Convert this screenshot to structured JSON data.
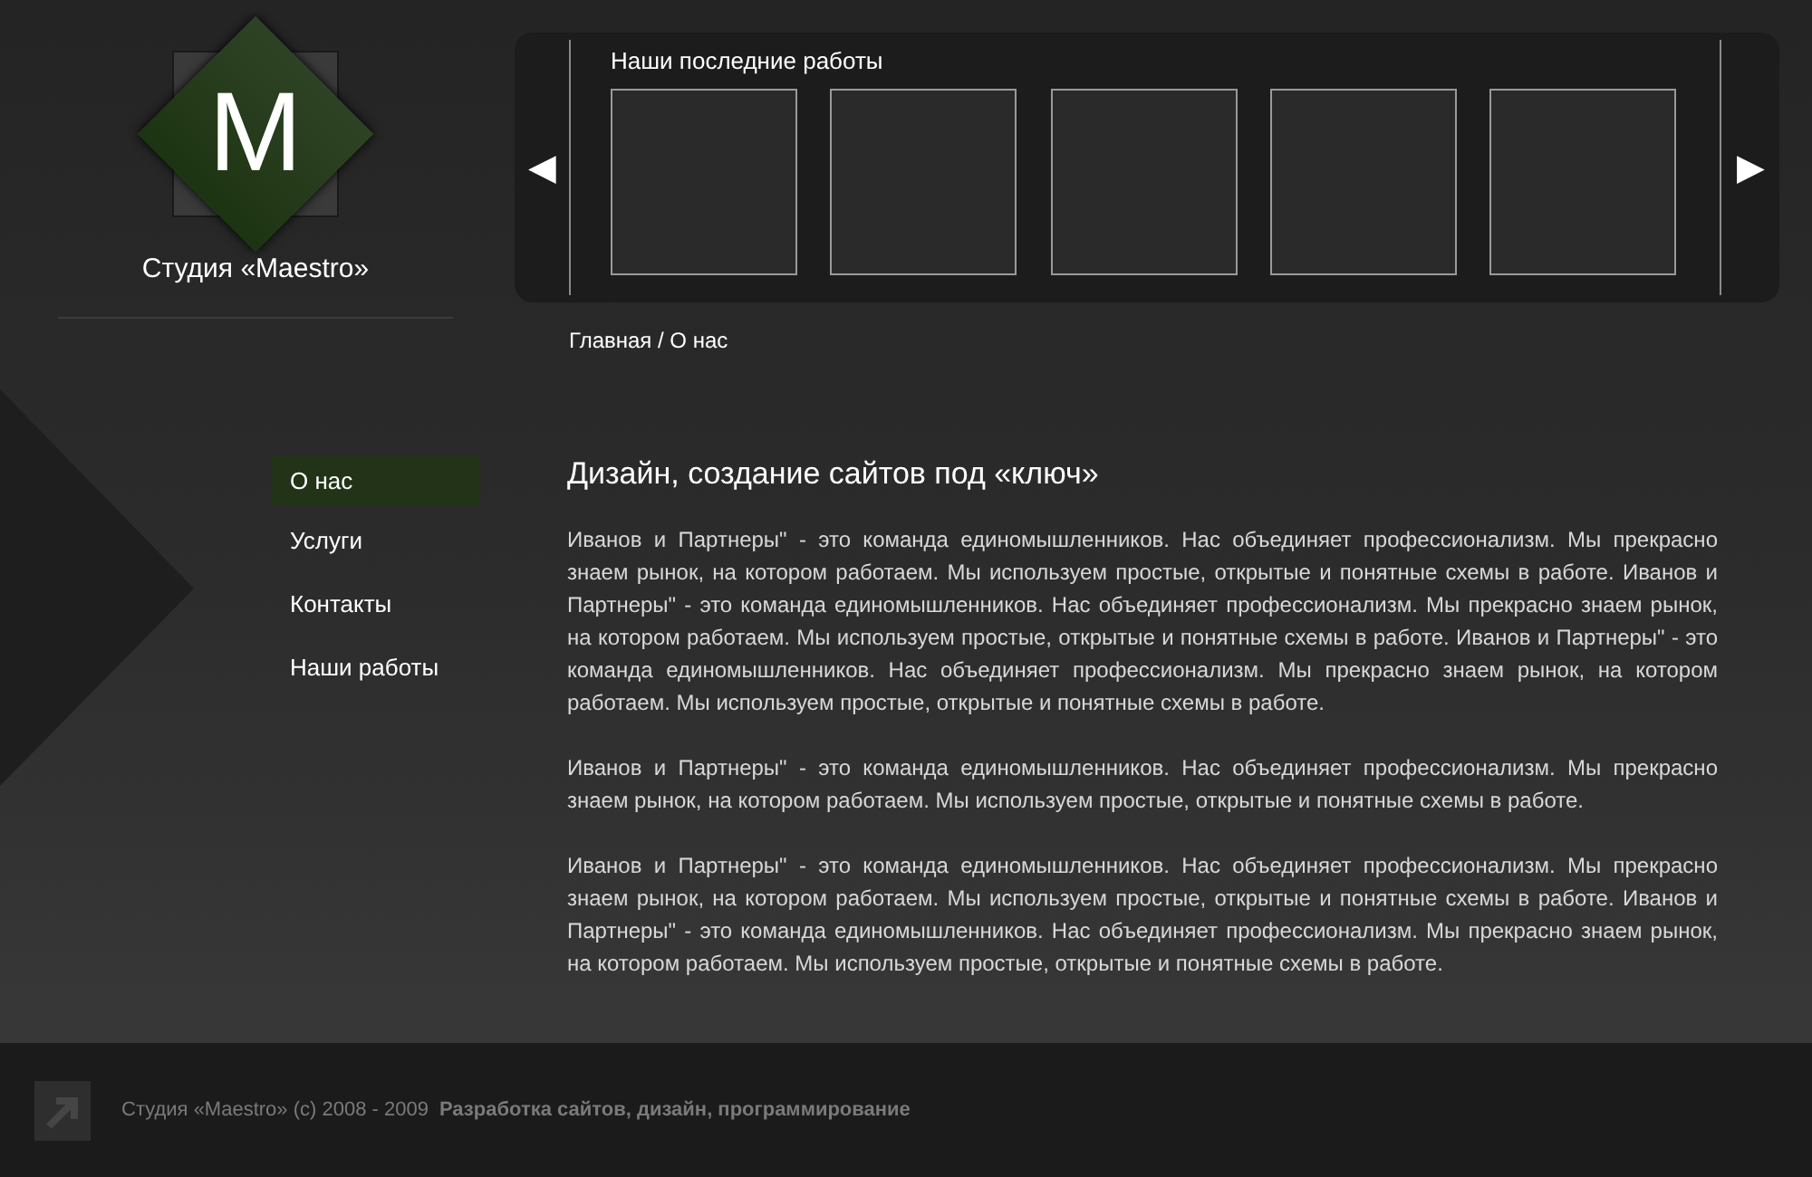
{
  "logo": {
    "letter": "M",
    "name": "Студия «Maestro»"
  },
  "slider": {
    "title": "Наши последние работы",
    "prev": "◀",
    "next": "▶",
    "works": [
      {
        "kind": "empty"
      },
      {
        "kind": "empty"
      },
      {
        "kind": "empty"
      },
      {
        "kind": "empty"
      },
      {
        "kind": "empty"
      }
    ]
  },
  "breadcrumb": "Главная / О нас",
  "menu": [
    {
      "label": "О нас",
      "selected": true
    },
    {
      "label": "Услуги",
      "selected": false
    },
    {
      "label": "Контакты",
      "selected": false
    },
    {
      "label": "Наши работы",
      "selected": false
    }
  ],
  "heading": "Дизайн, создание сайтов под «ключ»",
  "paragraphs": [
    "Иванов и Партнеры\" - это команда единомышленников. Нас объединяет профессионализм. Мы прекрасно знаем рынок, на котором работаем. Мы используем простые, открытые и понятные схемы в работе. Иванов и Партнеры\" - это команда единомышленников. Нас объединяет профессионализм. Мы прекрасно знаем рынок, на котором работаем. Мы используем простые, открытые и понятные схемы в работе. Иванов и Партнеры\" - это команда единомышленников. Нас объединяет профессионализм. Мы прекрасно знаем рынок, на котором работаем. Мы используем простые, открытые и понятные схемы в работе.",
    "Иванов и Партнеры\" - это команда единомышленников. Нас объединяет профессионализм. Мы прекрасно знаем рынок, на котором работаем. Мы используем простые, открытые и понятные схемы в работе.",
    "Иванов и Партнеры\" - это команда единомышленников. Нас объединяет профессионализм. Мы прекрасно знаем рынок, на котором работаем. Мы используем простые, открытые и понятные схемы в работе. Иванов и Партнеры\" - это команда единомышленников. Нас объединяет профессионализм. Мы прекрасно знаем рынок, на котором работаем. Мы используем простые, открытые и понятные схемы в работе."
  ],
  "footer": {
    "copyright": "Студия «Maestro» (c) 2008 - 2009",
    "tagline": "Разработка сайтов, дизайн, программирование"
  }
}
